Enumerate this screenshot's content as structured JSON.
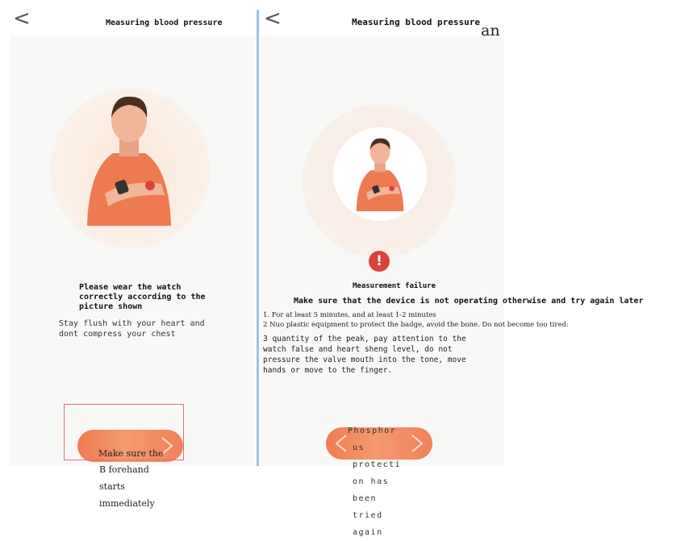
{
  "left_screen": {
    "title": "Measuring blood pressure",
    "back_glyph": "<",
    "instruction_heading_lines": [
      "Please wear the watch",
      "correctly according to the",
      "picture shown"
    ],
    "instruction_detail_lines": [
      "Stay flush with your heart and",
      "dont compress your chest"
    ],
    "button_label_lines": [
      "Make sure the",
      "B forehand",
      "starts",
      "immediately"
    ]
  },
  "right_screen": {
    "title": "Measuring blood pressure",
    "title_overlay": "an",
    "back_glyph": "<",
    "failure_title": "Measurement failure",
    "failure_subtitle": "Make sure that the device is not operating otherwise and try again later",
    "tips": [
      "1. For at least 5 minutes, and at least 1-2 minutes",
      "2 Nuo plastic equipment to protect the badge, avoid the bone. Do not become too tired:",
      "3 quantity of the peak, pay attention to the",
      "watch false and heart sheng level, do not",
      "pressure the valve mouth into the tone, move",
      "hands or move to the finger."
    ],
    "button_label_lines": [
      "Phosphor",
      "us",
      "protecti",
      "on has",
      "been",
      "tried",
      "again"
    ],
    "alert_glyph": "!"
  },
  "colors": {
    "accent": "#f07a52",
    "divider": "#9ebfe4",
    "alert": "#d9433c",
    "frame": "#d8727d"
  },
  "icons": [
    "back-arrow-icon",
    "alert-icon",
    "chevron-right-icon",
    "chevron-left-icon"
  ]
}
